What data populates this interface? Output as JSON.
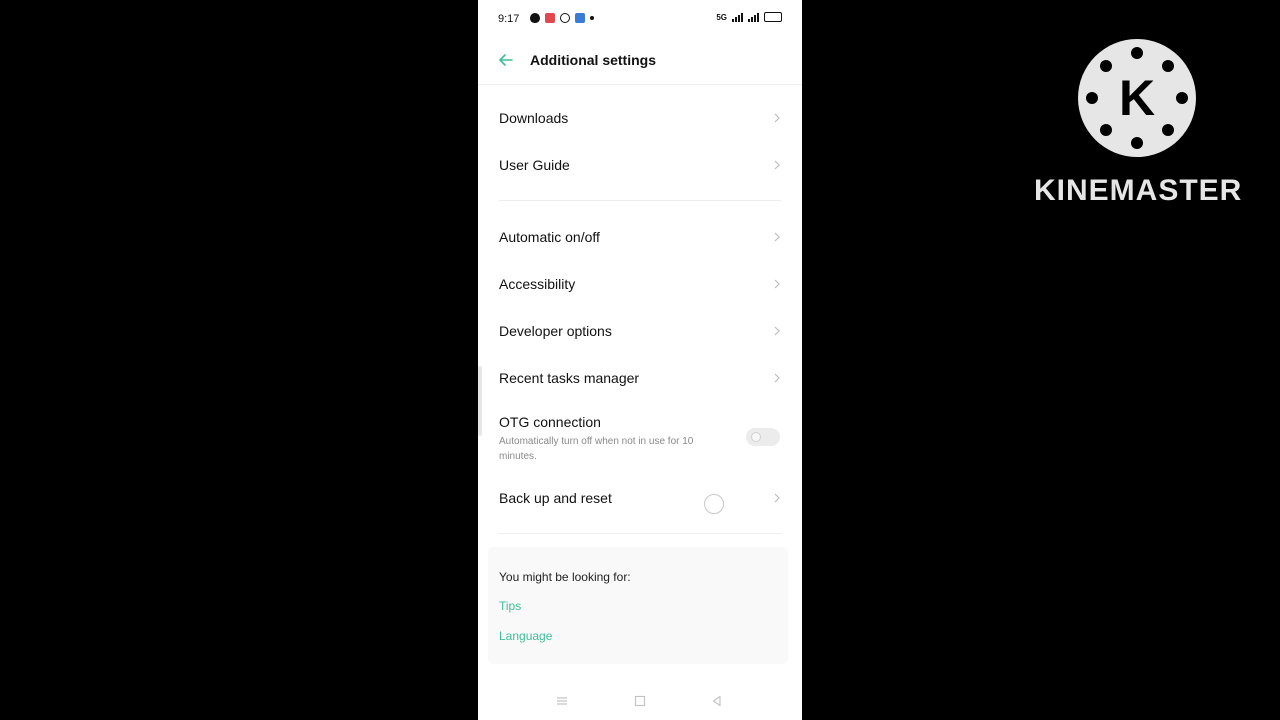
{
  "status_bar": {
    "time": "9:17",
    "net_label": "5G"
  },
  "header": {
    "title": "Additional settings",
    "back_icon": "arrow-left-icon"
  },
  "accent_color": "#3dbf97",
  "settings": {
    "downloads": "Downloads",
    "user_guide": "User Guide",
    "automatic_on_off": "Automatic on/off",
    "accessibility": "Accessibility",
    "developer_options": "Developer options",
    "recent_tasks_manager": "Recent tasks manager",
    "otg_connection": "OTG connection",
    "otg_description": "Automatically turn off when not in use for 10 minutes.",
    "otg_enabled": false,
    "back_up_and_reset": "Back up and reset"
  },
  "suggestions": {
    "title": "You might be looking for:",
    "links": [
      "Tips",
      "Language"
    ]
  },
  "watermark": {
    "brand": "KINEMASTER",
    "logo_letter": "K"
  }
}
